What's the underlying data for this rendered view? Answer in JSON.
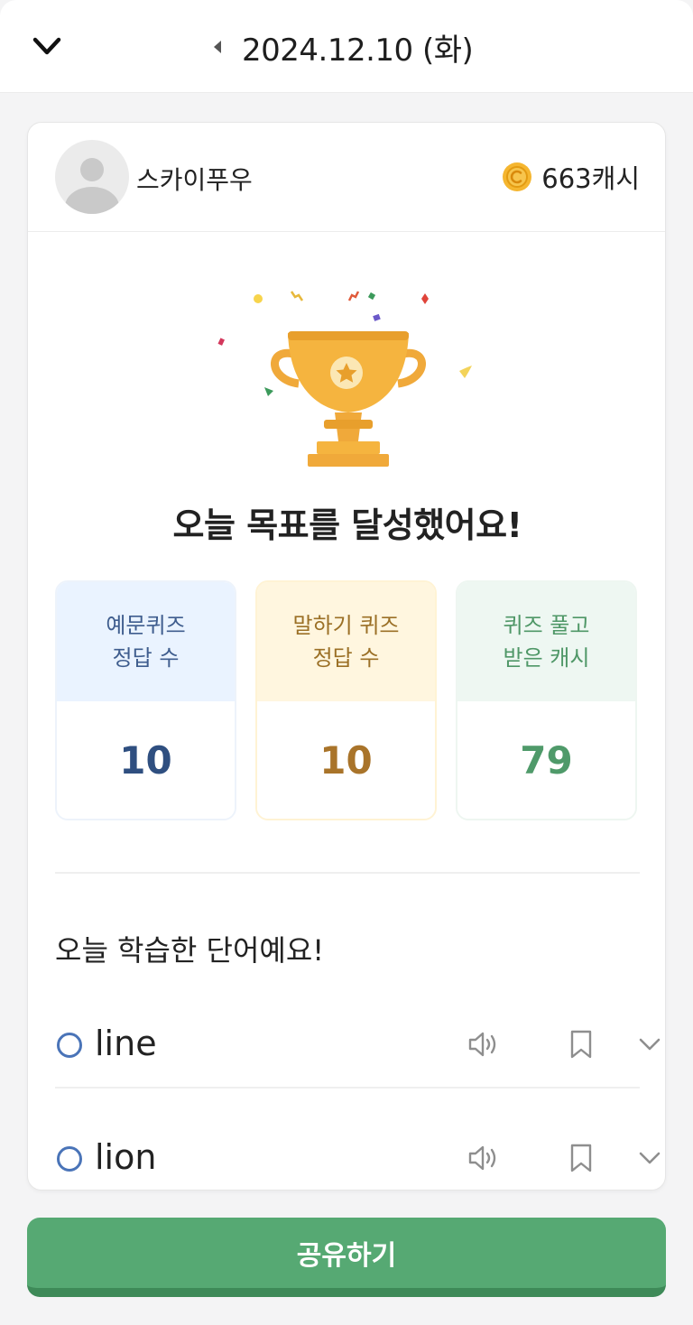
{
  "header": {
    "date": "2024.12.10 (화)",
    "icons": {
      "collapse": "chevron-down-icon",
      "prev": "caret-left-icon"
    }
  },
  "profile": {
    "nickname": "스카이푸우",
    "cash": "663캐시"
  },
  "goal": {
    "title": "오늘 목표를 달성했어요!"
  },
  "stats": [
    {
      "label": "예문퀴즈\n정답 수",
      "value": "10",
      "color": "#2f4f80"
    },
    {
      "label": "말하기 퀴즈\n정답 수",
      "value": "10",
      "color": "#a9742a"
    },
    {
      "label": "퀴즈 풀고\n받은 캐시",
      "value": "79",
      "color": "#4f9a6a"
    }
  ],
  "words_section": {
    "title": "오늘 학습한 단어예요!",
    "words": [
      {
        "word": "line"
      },
      {
        "word": "lion"
      }
    ]
  },
  "share_button": "공유하기",
  "colors": {
    "accent": "#56a973",
    "coin": "#f5b630"
  }
}
